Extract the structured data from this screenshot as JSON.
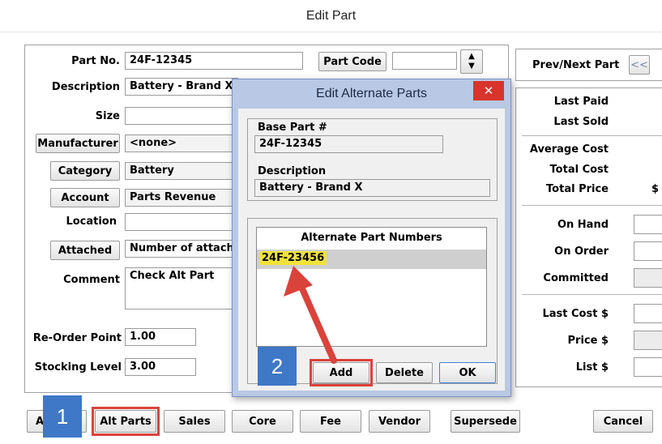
{
  "window": {
    "title": "Edit Part"
  },
  "form": {
    "part_no_label": "Part No.",
    "part_no_value": "24F-12345",
    "part_code_button": "Part Code",
    "description_label": "Description",
    "description_value": "Battery - Brand X",
    "size_label": "Size",
    "size_value": "",
    "manufacturer_button": "Manufacturer",
    "manufacturer_value": "<none>",
    "category_button": "Category",
    "category_value": "Battery",
    "account_button": "Account",
    "account_value": "Parts Revenue",
    "location_label": "Location",
    "location_value": "",
    "attached_button": "Attached",
    "attached_value": "Number of attache",
    "comment_label": "Comment",
    "comment_value": "Check Alt Part",
    "reorder_label": "Re-Order Point",
    "reorder_value": "1.00",
    "stocking_label": "Stocking Level",
    "stocking_value": "3.00"
  },
  "right_panel": {
    "prev_next_label": "Prev/Next Part",
    "prev_button": "<<",
    "last_paid": "Last Paid",
    "last_sold": "Last Sold",
    "average_cost": "Average Cost",
    "total_cost": "Total Cost",
    "total_price": "Total Price",
    "total_price_value": "$",
    "on_hand": "On Hand",
    "on_order": "On Order",
    "committed": "Committed",
    "last_cost": "Last Cost $",
    "price": "Price $",
    "list": "List $"
  },
  "bottom_buttons": {
    "first": "A",
    "alt_parts": "Alt Parts",
    "sales": "Sales",
    "core": "Core",
    "fee": "Fee",
    "vendor": "Vendor",
    "supersede": "Supersede",
    "cancel": "Cancel"
  },
  "dialog": {
    "title": "Edit Alternate Parts",
    "close_glyph": "✕",
    "base_part_label": "Base Part #",
    "base_part_value": "24F-12345",
    "description_label": "Description",
    "description_value": "Battery - Brand X",
    "list_header": "Alternate Part Numbers",
    "alternates": [
      "24F-23456"
    ],
    "add_button": "Add",
    "delete_button": "Delete",
    "ok_button": "OK"
  },
  "callouts": {
    "step1": "1",
    "step2": "2"
  },
  "colors": {
    "callout_blue": "#3f78c7",
    "annotation_red": "#d9433a",
    "dialog_frame": "#b9c8e4",
    "highlight_yellow": "#f0e23a"
  }
}
